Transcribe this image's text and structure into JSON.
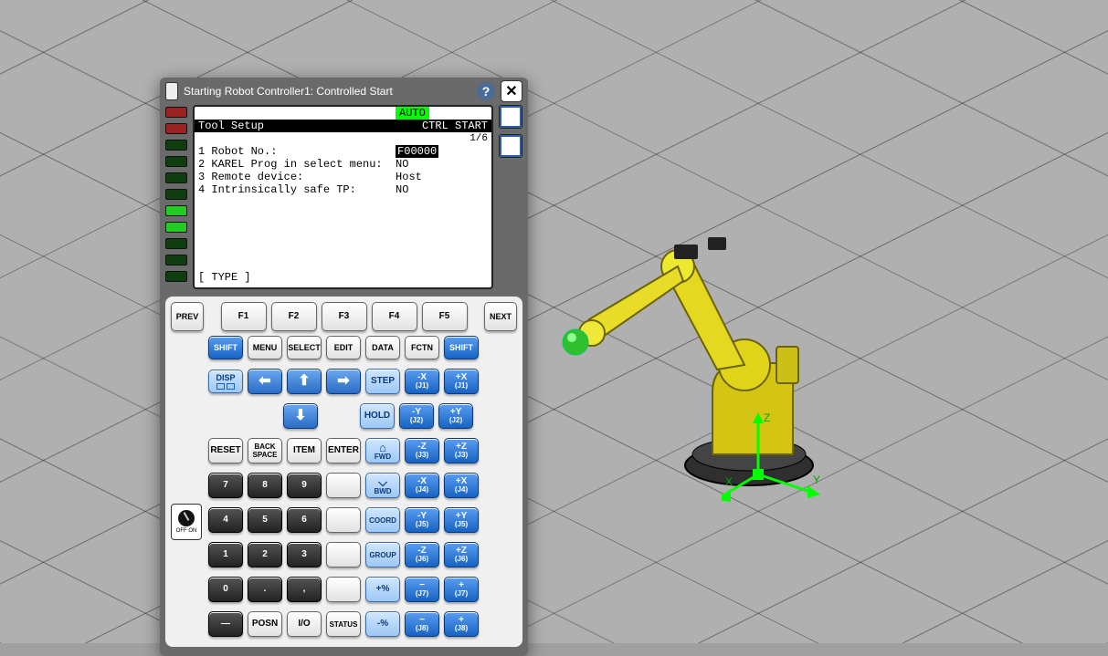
{
  "window": {
    "title": "Starting Robot Controller1: Controlled Start"
  },
  "screen": {
    "auto": "AUTO",
    "header_left": "Tool Setup",
    "header_right": "CTRL START",
    "page": "1/6",
    "rows": [
      {
        "n": "1",
        "label": "Robot No.:",
        "val": "F00000",
        "sel": true
      },
      {
        "n": "2",
        "label": "KAREL Prog in select menu:",
        "val": "NO",
        "sel": false
      },
      {
        "n": "3",
        "label": "Remote device:",
        "val": "Host",
        "sel": false
      },
      {
        "n": "4",
        "label": "Intrinsically safe TP:",
        "val": "NO",
        "sel": false
      }
    ],
    "footer": "[ TYPE ]"
  },
  "keys": {
    "prev": "PREV",
    "next": "NEXT",
    "f1": "F1",
    "f2": "F2",
    "f3": "F3",
    "f4": "F4",
    "f5": "F5",
    "shift": "SHIFT",
    "menu": "MENU",
    "select": "SELECT",
    "edit": "EDIT",
    "data": "DATA",
    "fctn": "FCTN",
    "disp": "DISP",
    "reset": "RESET",
    "backspace": "BACK SPACE",
    "item": "ITEM",
    "enter": "ENTER",
    "step": "STEP",
    "hold": "HOLD",
    "fwd": "FWD",
    "bwd": "BWD",
    "coord": "COORD",
    "group": "GROUP",
    "posn": "POSN",
    "io": "I/O",
    "status": "STATUS",
    "pluspct": "+%",
    "minuspct": "-%",
    "numpad": [
      "7",
      "8",
      "9",
      "4",
      "5",
      "6",
      "1",
      "2",
      "3",
      "0",
      ".",
      ","
    ],
    "minus": "—",
    "offon": "OFF  ON",
    "jog": {
      "mx": "-X",
      "px": "+X",
      "j1": "(J1)",
      "my": "-Y",
      "py": "+Y",
      "j2": "(J2)",
      "mz": "-Z",
      "pz": "+Z",
      "j3": "(J3)",
      "mx2": "-X",
      "px2": "+X",
      "j4": "(J4)",
      "my2": "-Y",
      "py2": "+Y",
      "j5": "(J5)",
      "mz2": "-Z",
      "pz2": "+Z",
      "j6": "(J6)",
      "m7": "−",
      "p7": "+",
      "j7": "(J7)",
      "m8": "−",
      "p8": "+",
      "j8": "(J8)"
    }
  },
  "axis": {
    "x": "X",
    "y": "Y",
    "z": "Z"
  }
}
